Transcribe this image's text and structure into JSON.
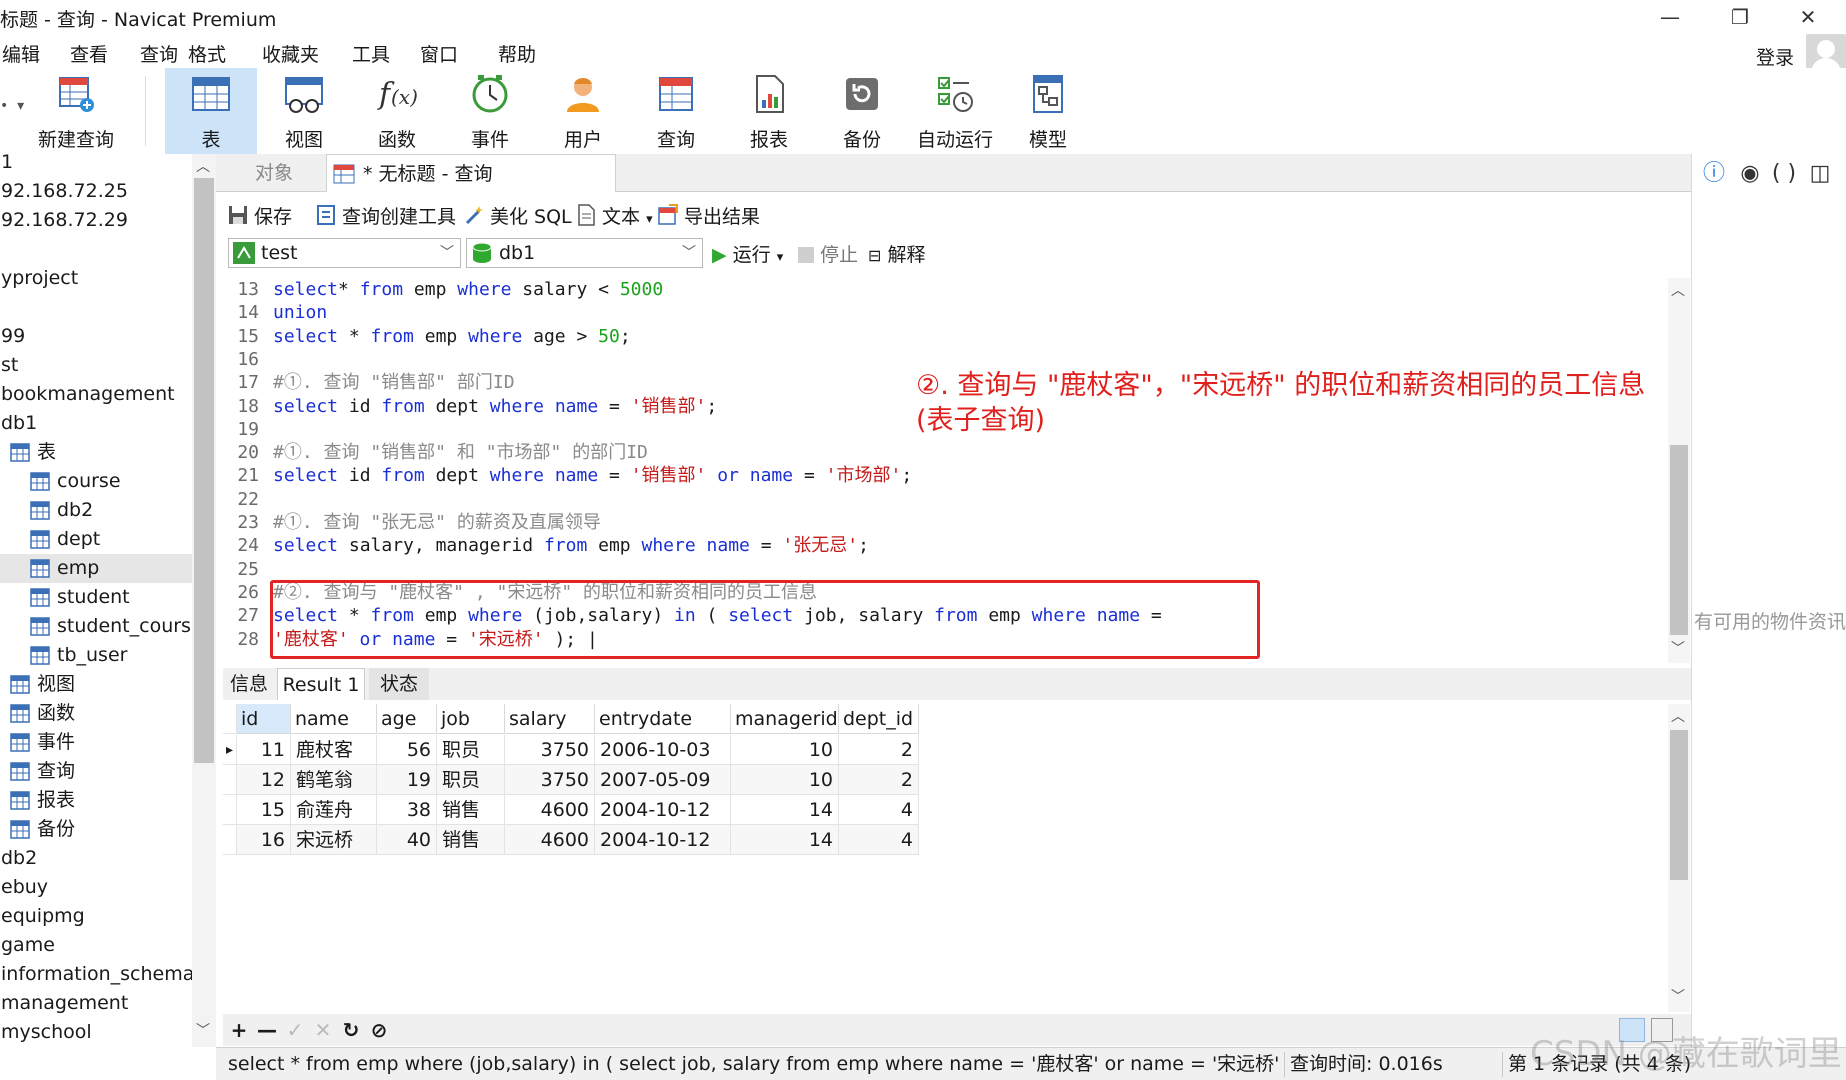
{
  "window": {
    "title": "标题 - 查询 - Navicat Premium",
    "minimize": "—",
    "maximize": "❐",
    "close": "✕"
  },
  "menu": {
    "items": [
      "编辑",
      "查看",
      "查询",
      "格式",
      "收藏夹",
      "工具",
      "窗口",
      "帮助"
    ],
    "login": "登录"
  },
  "ribbon": {
    "items": [
      {
        "label": "新建查询",
        "icon": "new-query-icon"
      },
      {
        "label": "表",
        "icon": "table-icon",
        "active": true
      },
      {
        "label": "视图",
        "icon": "view-icon"
      },
      {
        "label": "函数",
        "icon": "function-icon"
      },
      {
        "label": "事件",
        "icon": "event-clock-icon"
      },
      {
        "label": "用户",
        "icon": "user-icon"
      },
      {
        "label": "查询",
        "icon": "query-icon"
      },
      {
        "label": "报表",
        "icon": "report-icon"
      },
      {
        "label": "备份",
        "icon": "backup-icon"
      },
      {
        "label": "自动运行",
        "icon": "automation-icon"
      },
      {
        "label": "模型",
        "icon": "model-icon"
      }
    ]
  },
  "tree": {
    "nodes": [
      {
        "label": "1",
        "indent": 0
      },
      {
        "label": "92.168.72.25",
        "indent": 0
      },
      {
        "label": "92.168.72.29",
        "indent": 0
      },
      {
        "label": "",
        "indent": 0
      },
      {
        "label": "yproject",
        "indent": 0
      },
      {
        "label": "",
        "indent": 0
      },
      {
        "label": "99",
        "indent": 0
      },
      {
        "label": "st",
        "indent": 0
      },
      {
        "label": "bookmanagement",
        "indent": 0
      },
      {
        "label": "db1",
        "indent": 0
      },
      {
        "label": "表",
        "indent": 20,
        "icon": "table-icon"
      },
      {
        "label": "course",
        "indent": 40,
        "icon": "table-icon"
      },
      {
        "label": "db2",
        "indent": 40,
        "icon": "table-icon"
      },
      {
        "label": "dept",
        "indent": 40,
        "icon": "table-icon"
      },
      {
        "label": "emp",
        "indent": 40,
        "icon": "table-icon",
        "selected": true
      },
      {
        "label": "student",
        "indent": 40,
        "icon": "table-icon"
      },
      {
        "label": "student_course",
        "indent": 40,
        "icon": "table-icon"
      },
      {
        "label": "tb_user",
        "indent": 40,
        "icon": "table-icon"
      },
      {
        "label": "视图",
        "indent": 20,
        "icon": "view-icon"
      },
      {
        "label": "函数",
        "indent": 20,
        "icon": "function-icon"
      },
      {
        "label": "事件",
        "indent": 20,
        "icon": "event-icon"
      },
      {
        "label": "查询",
        "indent": 20,
        "icon": "query-icon"
      },
      {
        "label": "报表",
        "indent": 20,
        "icon": "report-icon"
      },
      {
        "label": "备份",
        "indent": 20,
        "icon": "backup-icon"
      },
      {
        "label": "db2",
        "indent": 0
      },
      {
        "label": "ebuy",
        "indent": 0
      },
      {
        "label": "equipmg",
        "indent": 0
      },
      {
        "label": "game",
        "indent": 0
      },
      {
        "label": "information_schema",
        "indent": 0
      },
      {
        "label": "management",
        "indent": 0
      },
      {
        "label": "myschool",
        "indent": 0
      }
    ]
  },
  "tabs": {
    "objects": "对象",
    "query": "* 无标题 - 查询"
  },
  "query_toolbar": {
    "save": "保存",
    "builder": "查询创建工具",
    "beautify": "美化 SQL",
    "text": "文本",
    "export": "导出结果"
  },
  "selectors": {
    "connection": "test",
    "database": "db1",
    "run": "运行",
    "stop": "停止",
    "explain": "解释"
  },
  "editor": {
    "lines": [
      {
        "n": "13",
        "code": [
          [
            "kw",
            "select"
          ],
          [
            "",
            "* "
          ],
          [
            "kw",
            "from"
          ],
          [
            "",
            " emp "
          ],
          [
            "kw",
            "where"
          ],
          [
            "",
            " salary < "
          ],
          [
            "num",
            "5000"
          ]
        ]
      },
      {
        "n": "14",
        "code": [
          [
            "kw",
            "union"
          ]
        ]
      },
      {
        "n": "15",
        "code": [
          [
            "kw",
            "select"
          ],
          [
            "",
            " * "
          ],
          [
            "kw",
            "from"
          ],
          [
            "",
            " emp "
          ],
          [
            "kw",
            "where"
          ],
          [
            "",
            " age > "
          ],
          [
            "num",
            "50"
          ],
          [
            "",
            ";"
          ]
        ]
      },
      {
        "n": "16",
        "code": []
      },
      {
        "n": "17",
        "code": [
          [
            "cmt",
            "#①. 查询 \"销售部\" 部门ID"
          ]
        ]
      },
      {
        "n": "18",
        "code": [
          [
            "kw",
            "select"
          ],
          [
            "",
            " id "
          ],
          [
            "kw",
            "from"
          ],
          [
            "",
            " dept "
          ],
          [
            "kw",
            "where"
          ],
          [
            "",
            " "
          ],
          [
            "kw",
            "name"
          ],
          [
            "",
            " = "
          ],
          [
            "str",
            "'销售部'"
          ],
          [
            "",
            ";"
          ]
        ]
      },
      {
        "n": "19",
        "code": []
      },
      {
        "n": "20",
        "code": [
          [
            "cmt",
            "#①. 查询 \"销售部\" 和 \"市场部\" 的部门ID"
          ]
        ]
      },
      {
        "n": "21",
        "code": [
          [
            "kw",
            "select"
          ],
          [
            "",
            " id "
          ],
          [
            "kw",
            "from"
          ],
          [
            "",
            " dept "
          ],
          [
            "kw",
            "where"
          ],
          [
            "",
            " "
          ],
          [
            "kw",
            "name"
          ],
          [
            "",
            " = "
          ],
          [
            "str",
            "'销售部'"
          ],
          [
            "",
            " "
          ],
          [
            "kw",
            "or"
          ],
          [
            "",
            " "
          ],
          [
            "kw",
            "name"
          ],
          [
            "",
            " = "
          ],
          [
            "str",
            "'市场部'"
          ],
          [
            "",
            ";"
          ]
        ]
      },
      {
        "n": "22",
        "code": []
      },
      {
        "n": "23",
        "code": [
          [
            "cmt",
            "#①. 查询 \"张无忌\" 的薪资及直属领导"
          ]
        ]
      },
      {
        "n": "24",
        "code": [
          [
            "kw",
            "select"
          ],
          [
            "",
            " salary, managerid "
          ],
          [
            "kw",
            "from"
          ],
          [
            "",
            " emp "
          ],
          [
            "kw",
            "where"
          ],
          [
            "",
            " "
          ],
          [
            "kw",
            "name"
          ],
          [
            "",
            " = "
          ],
          [
            "str",
            "'张无忌'"
          ],
          [
            "",
            ";"
          ]
        ]
      },
      {
        "n": "25",
        "code": []
      },
      {
        "n": "26",
        "code": [
          [
            "cmt",
            "#②. 查询与 \"鹿杖客\" , \"宋远桥\" 的职位和薪资相同的员工信息"
          ]
        ]
      },
      {
        "n": "27",
        "code": [
          [
            "kw",
            "select"
          ],
          [
            "",
            " * "
          ],
          [
            "kw",
            "from"
          ],
          [
            "",
            " emp "
          ],
          [
            "kw",
            "where"
          ],
          [
            "",
            " (job,salary) "
          ],
          [
            "kw",
            "in"
          ],
          [
            "",
            " ( "
          ],
          [
            "kw",
            "select"
          ],
          [
            "",
            " job, salary "
          ],
          [
            "kw",
            "from"
          ],
          [
            "",
            " emp "
          ],
          [
            "kw",
            "where"
          ],
          [
            "",
            " "
          ],
          [
            "kw",
            "name"
          ],
          [
            "",
            " ="
          ]
        ]
      },
      {
        "n": "28",
        "code": [
          [
            "str",
            "'鹿杖客'"
          ],
          [
            "",
            " "
          ],
          [
            "kw",
            "or"
          ],
          [
            "",
            " "
          ],
          [
            "kw",
            "name"
          ],
          [
            "",
            " = "
          ],
          [
            "str",
            "'宋远桥'"
          ],
          [
            "",
            " ); |"
          ]
        ]
      }
    ]
  },
  "annotation": "②. 查询与 \"鹿杖客\"，\"宋远桥\" 的职位和薪资相同的员工信息\n(表子查询)",
  "result_tabs": [
    "信息",
    "Result 1",
    "状态"
  ],
  "grid": {
    "columns": [
      "id",
      "name",
      "age",
      "job",
      "salary",
      "entrydate",
      "managerid",
      "dept_id"
    ],
    "rows": [
      [
        "11",
        "鹿杖客",
        "56",
        "职员",
        "3750",
        "2006-10-03",
        "10",
        "2"
      ],
      [
        "12",
        "鹤笔翁",
        "19",
        "职员",
        "3750",
        "2007-05-09",
        "10",
        "2"
      ],
      [
        "15",
        "俞莲舟",
        "38",
        "销售",
        "4600",
        "2004-10-12",
        "14",
        "4"
      ],
      [
        "16",
        "宋远桥",
        "40",
        "销售",
        "4600",
        "2004-10-12",
        "14",
        "4"
      ]
    ]
  },
  "grid_toolbar": {
    "add": "+",
    "remove": "—",
    "apply": "✓",
    "discard": "✕",
    "refresh": "↻",
    "stop": "⊘"
  },
  "status": {
    "sql": "select * from emp where (job,salary) in ( select job, salary from emp where name = '鹿杖客' or name = '宋远桥'",
    "time": "查询时间: 0.016s",
    "records": "第 1 条记录 (共 4 条)"
  },
  "right_panel": {
    "text": "有可用的物件资讯"
  },
  "watermark": "CSDN @藏在歌词里"
}
